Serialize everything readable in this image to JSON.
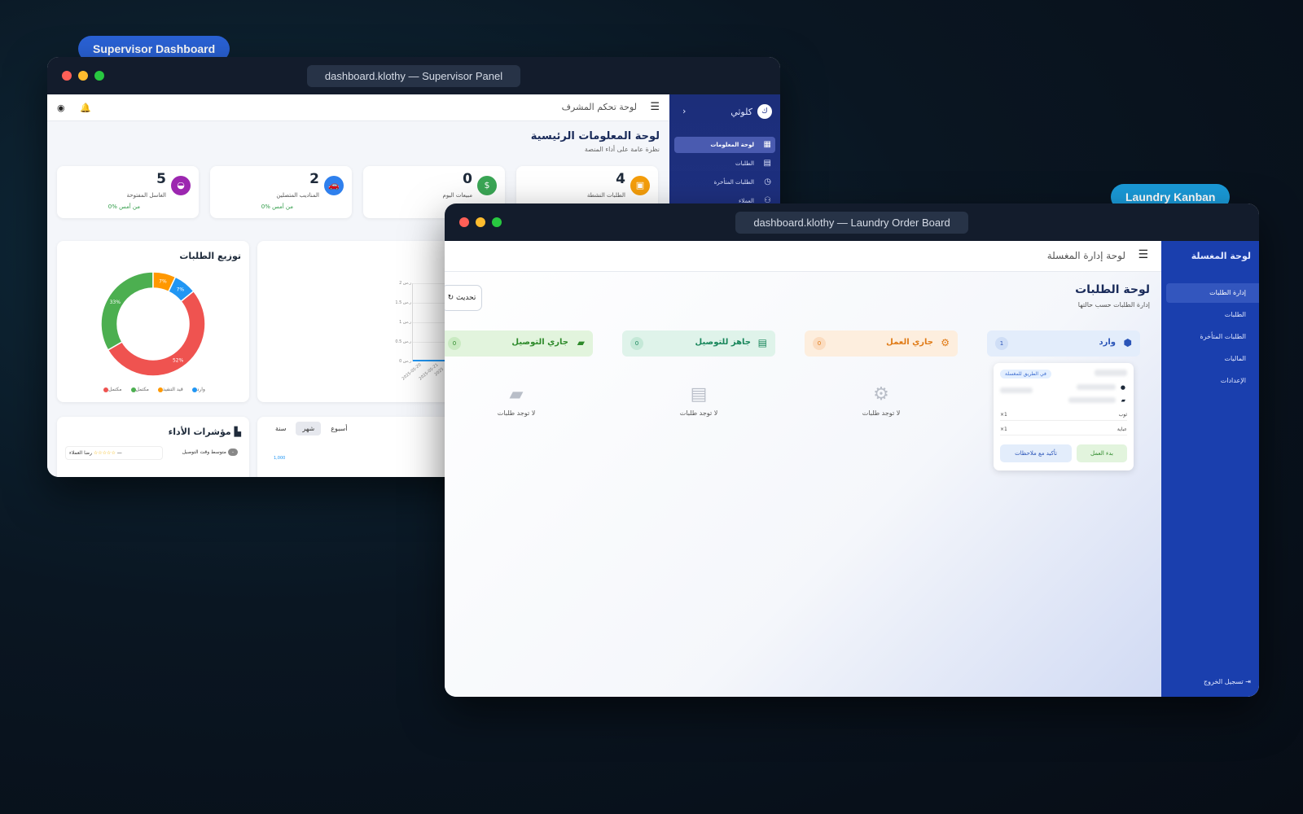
{
  "labels": {
    "supervisor": "Supervisor Dashboard",
    "kanban": "Laundry Kanban"
  },
  "supervisor": {
    "window_title": "dashboard.klothy — Supervisor Panel",
    "topbar_title": "لوحة تحكم المشرف",
    "brand": "كلوثي",
    "brand_logo": "ك",
    "nav": [
      "لوحة المعلومات",
      "الطلبات",
      "الطلبات المتأخرة",
      "العملاء"
    ],
    "page_title": "لوحة المعلومات الرئيسية",
    "page_subtitle": "نظرة عامة على أداء المنصة",
    "stats": [
      {
        "value": "4",
        "label": "الطلبات النشطة",
        "trend": "",
        "color": "#f59e0b",
        "icon": "clipboard-icon"
      },
      {
        "value": "0",
        "label": "مبيعات اليوم",
        "trend": "",
        "color": "#3aa655",
        "icon": "dollar-icon"
      },
      {
        "value": "2",
        "label": "المناديب المتصلين",
        "trend": "0% من أمس",
        "color": "#2f80ed",
        "icon": "car-icon"
      },
      {
        "value": "5",
        "label": "الغاسل المفتوحة",
        "trend": "0% من أمس",
        "color": "#9c27b0",
        "icon": "iron-icon"
      }
    ],
    "distribution": {
      "title": "توزيع الطلبات",
      "legend": [
        "مكتمل",
        "مكتمل",
        "قيد التنفيذ",
        "وارد"
      ],
      "pcts": [
        "52%",
        "33%",
        "7%",
        "7%"
      ]
    },
    "line_chart": {
      "y_ticks": [
        "0 ر.س",
        "0.5 ر.س",
        "1 ر.س",
        "1.5 ر.س",
        "2 ر.س"
      ],
      "x_ticks": [
        "2025-05-20",
        "2025-05-21",
        "2025"
      ]
    },
    "kpi": {
      "title": "مؤشرات الأداء",
      "avg_delivery": "متوسط وقت التوصيل",
      "avg_delivery_value": "-",
      "satisfaction": "رضا العملاء",
      "satisfaction_value": "—"
    },
    "period_tabs": [
      "سنة",
      "شهر",
      "أسبوع"
    ],
    "mini_value": "1,000"
  },
  "chart_data": {
    "type": "pie",
    "title": "توزيع الطلبات",
    "categories": [
      "مكتمل",
      "مكتمل",
      "قيد التنفيذ",
      "وارد"
    ],
    "values": [
      52,
      33,
      7,
      7
    ],
    "colors": [
      "#ef5350",
      "#4caf50",
      "#ff9800",
      "#2196f3"
    ]
  },
  "kanban": {
    "window_title": "dashboard.klothy — Laundry Order Board",
    "topbar_title": "لوحة إدارة المغسلة",
    "brand": "لوحة المغسلة",
    "nav": [
      "إدارة الطلبات",
      "الطلبات",
      "الطلبات المتأخرة",
      "الماليات",
      "الإعدادات"
    ],
    "logout": "تسجيل الخروج",
    "page_title": "لوحة الطلبات",
    "page_subtitle": "إدارة الطلبات حسب حالتها",
    "refresh": "تحديث",
    "columns": [
      {
        "name": "وارد",
        "count": "1",
        "bg": "#e3edfb",
        "fg": "#2b55b8",
        "icon": "box-icon"
      },
      {
        "name": "جاري العمل",
        "count": "0",
        "bg": "#fdeede",
        "fg": "#e07b17",
        "icon": "wrench-icon"
      },
      {
        "name": "جاهز للتوصيل",
        "count": "0",
        "bg": "#dff3ea",
        "fg": "#18865b",
        "icon": "receipt-icon"
      },
      {
        "name": "جاري التوصيل",
        "count": "0",
        "bg": "#e2f4dd",
        "fg": "#2e8a2b",
        "icon": "truck-icon"
      }
    ],
    "empty_text": "لا توجد طلبات",
    "order": {
      "status_badge": "في الطريق للمغسلة",
      "items": [
        {
          "name": "ثوب",
          "qty": "×1"
        },
        {
          "name": "عباية",
          "qty": "×1"
        }
      ],
      "start_btn": "بدء العمل",
      "confirm_btn": "تأكيد مع ملاحظات"
    }
  }
}
